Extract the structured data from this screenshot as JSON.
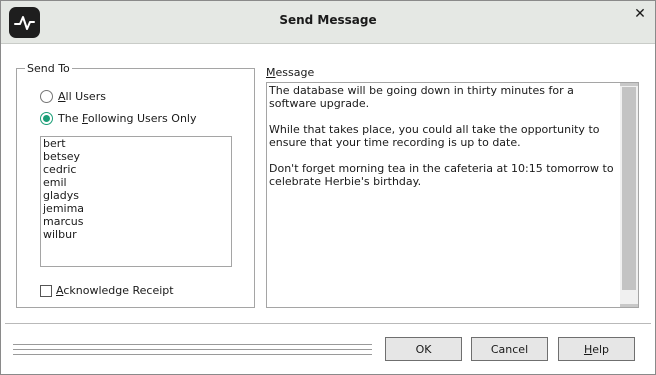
{
  "window": {
    "title": "Send Message",
    "close_glyph": "✕"
  },
  "send_to": {
    "legend": "Send To",
    "all_users": {
      "mnemonic": "A",
      "rest": "ll Users",
      "checked": false
    },
    "following": {
      "prefix": "The ",
      "mnemonic": "F",
      "rest": "ollowing Users Only",
      "checked": true
    },
    "users": [
      "bert",
      "betsey",
      "cedric",
      "emil",
      "gladys",
      "jemima",
      "marcus",
      "wilbur"
    ],
    "acknowledge": {
      "mnemonic": "A",
      "rest": "cknowledge Receipt",
      "checked": false
    }
  },
  "message": {
    "label_mnemonic": "M",
    "label_rest": "essage",
    "paragraphs": [
      "The database will be going down in thirty minutes for a software upgrade.",
      "While that takes place, you could all take the opportunity to ensure that your time recording is up to date.",
      "Don't forget morning tea in the cafeteria at 10:15 tomorrow to celebrate Herbie's birthday."
    ]
  },
  "buttons": {
    "ok": "OK",
    "cancel": "Cancel",
    "help_mnemonic": "H",
    "help_rest": "elp"
  },
  "colors": {
    "titlebar": "#e5e8e4",
    "accent": "#1b9e77"
  },
  "icons": {
    "app": "pulse-logo-icon",
    "close": "close-icon"
  }
}
